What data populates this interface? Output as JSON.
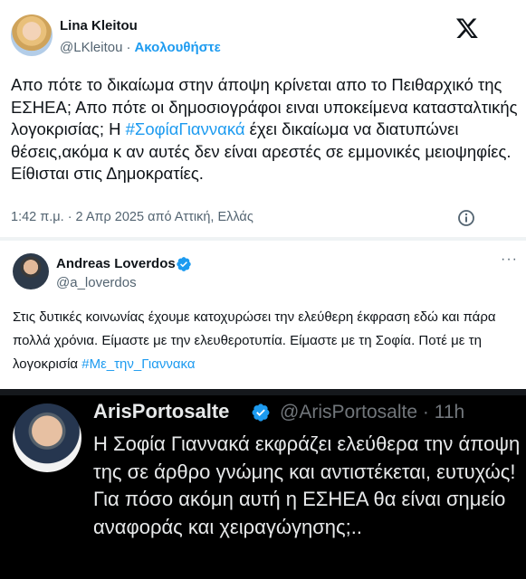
{
  "tweet1": {
    "author_name": "Lina Kleitou",
    "author_handle": "@LKleitou",
    "separator": "·",
    "follow_label": "Ακολουθήστε",
    "text_part1": "Απο πότε το δικαίωμα στην άποψη κρίνεται απο το Πειθαρχικό της ΕΣΗΕΑ; Απο πότε οι δημοσιογράφοι ειναι υποκείμενα κατασταλτικής λογοκρισίας;  Η ",
    "hashtag": "#ΣοφίαΓιαννακά",
    "text_part2": " έχει δικαίωμα να διατυπώνει θέσεις,ακόμα κ αν αυτές δεν είναι αρεστές σε εμμονικές μειοψηφίες. Είθισται στις Δημοκρατίες.",
    "timestamp": "1:42 π.μ. · 2 Απρ 2025 από Αττική, Ελλάς",
    "icons": {
      "brand": "x-logo-icon",
      "info": "info-icon"
    }
  },
  "tweet2": {
    "author_name": "Andreas Loverdos",
    "author_handle": "@a_loverdos",
    "more_label": "···",
    "text": "Στις δυτικές κοινωνίας έχουμε κατοχυρώσει την ελεύθερη έκφραση εδώ και πάρα πολλά χρόνια. Είμαστε με την ελευθεροτυπία. Είμαστε με τη Σοφία. Ποτέ με τη λογοκρισία ",
    "hashtag": "#Με_την_Γιαννακα",
    "icons": {
      "verified": "verified-badge-icon"
    }
  },
  "tweet3": {
    "author_name": "ArisPortosalte",
    "author_handle": "@ArisPortosalte · 11h",
    "line1": "Η Σοφία Γιαννακά εκφράζει ελεύθερα την άποψη της σε άρθρο γνώμης και αντιστέκεται, ευτυχώς!",
    "line2": "Για πόσο ακόμη αυτή η ΕΣΗΕΑ θα είναι σημείο αναφοράς και χειραγώγησης;..",
    "icons": {
      "verified": "verified-badge-icon"
    }
  },
  "colors": {
    "accent": "#1d9bf0",
    "text_primary": "#0f1419",
    "text_secondary": "#536471",
    "dark_bg": "#000000",
    "dark_text": "#e7e9ea",
    "dark_secondary": "#71767b"
  }
}
